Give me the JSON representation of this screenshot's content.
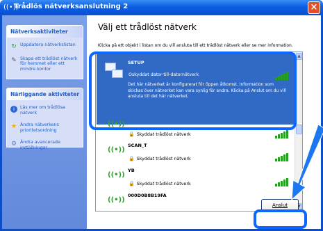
{
  "window": {
    "title": "Trådlös nätverksanslutning 2",
    "close_label": "×",
    "title_icon": "((•))"
  },
  "tasks": {
    "network_section": {
      "title": "Nätverksaktiviteter",
      "items": [
        {
          "icon": "refresh-icon",
          "glyph": "↻",
          "label": "Uppdatera nätverkslistan"
        },
        {
          "icon": "setup-network-icon",
          "glyph": "✎",
          "label": "Skapa ett trådlöst nätverk för hemmet eller ett mindre kontor"
        }
      ]
    },
    "related_section": {
      "title": "Närliggande aktiviteter",
      "items": [
        {
          "icon": "info-icon",
          "glyph": "i",
          "label": "Läs mer om trådlösa nätverk"
        },
        {
          "icon": "star-icon",
          "glyph": "★",
          "label": "Ändra nätverkens prioritetsordning"
        },
        {
          "icon": "settings-icon",
          "glyph": "⚙",
          "label": "Ändra avancerade inställningar"
        }
      ]
    }
  },
  "main": {
    "title": "Välj ett trådlöst nätverk",
    "subtitle": "Klicka på ett objekt i listan om du vill ansluta till ett trådlöst nätverk eller se mer information.",
    "networks": [
      {
        "name": "SETUP",
        "status": "Oskyddat dator-till-datornätverk",
        "description": "Det här nätverket är konfigurerat för öppen åtkomst. Information som skickas över nätverket kan vara synlig för andra. Klicka på Anslut om du vill ansluta till det här nätverket.",
        "selected": true
      },
      {
        "name": "",
        "status": "Skyddat trådlöst nätverk",
        "selected": false
      },
      {
        "name": "SCAN_T",
        "status": "Skyddat trådlöst nätverk",
        "selected": false
      },
      {
        "name": "YB",
        "status": "Skyddat trådlöst nätverk",
        "selected": false
      },
      {
        "name": "000D0B8B19FA",
        "status": "",
        "selected": false
      }
    ],
    "signal_glyph": "((•))",
    "lock_glyph": "🔒",
    "connect_label": "Anslut"
  },
  "colors": {
    "title_bar": "#0b5ee0",
    "task_pane": "#6f96e3",
    "selection": "#316ac5",
    "highlight": "#0c66ff",
    "signal": "#25a021"
  }
}
